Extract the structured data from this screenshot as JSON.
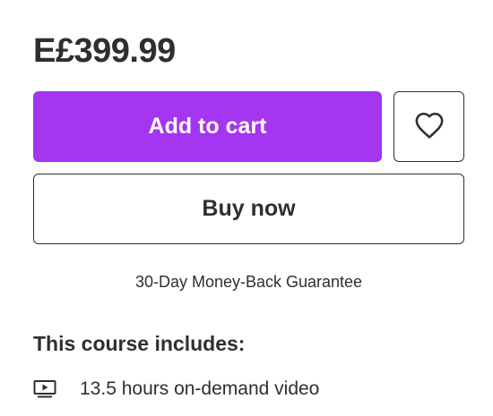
{
  "course_card": {
    "price": "E£399.99",
    "add_to_cart_label": "Add to cart",
    "buy_now_label": "Buy now",
    "guarantee_text": "30-Day Money-Back Guarantee",
    "includes_title": "This course includes:",
    "includes": [
      {
        "icon": "video-icon",
        "text": "13.5 hours on-demand video"
      }
    ]
  },
  "colors": {
    "accent": "#a435f0",
    "text": "#2d2f31",
    "background": "#ffffff"
  },
  "icons": {
    "wishlist": "heart-icon"
  }
}
